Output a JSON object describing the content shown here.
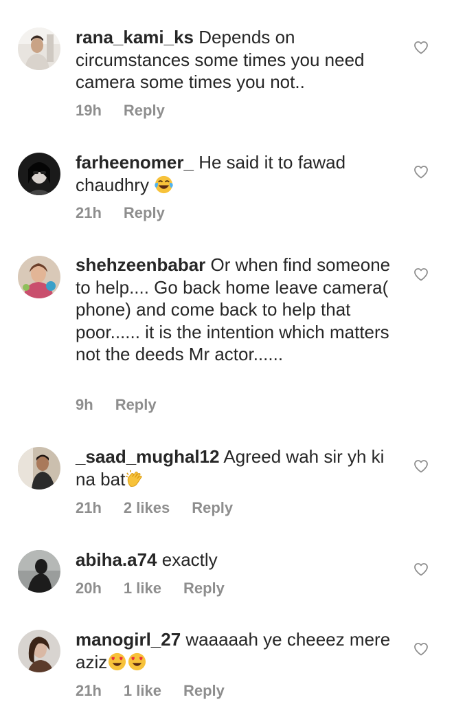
{
  "colors": {
    "text": "#262626",
    "meta": "#8e8e8e",
    "background": "#ffffff"
  },
  "comments": [
    {
      "username": "rana_kami_ks",
      "text": "Depends on circumstances some times you need camera some times you not..",
      "time": "19h",
      "likes": "",
      "reply": "Reply",
      "avatar_icon": "avatar-photo-man-icon"
    },
    {
      "username": "farheenomer_",
      "text": "He said it to fawad chaudhry",
      "emojis": [
        "face-with-tears-of-joy-icon"
      ],
      "time": "21h",
      "likes": "",
      "reply": "Reply",
      "avatar_icon": "avatar-photo-woman-icon"
    },
    {
      "username": "shehzeenbabar",
      "text": "Or when find someone to help.... Go back home leave camera( phone) and come back to help that poor...... it is the intention which matters not the deeds Mr actor......",
      "time": "9h",
      "likes": "",
      "reply": "Reply",
      "avatar_icon": "avatar-photo-woman-icon"
    },
    {
      "username": "_saad_mughal12",
      "text": "Agreed wah sir yh ki na bat",
      "emojis": [
        "clapping-hands-icon"
      ],
      "time": "21h",
      "likes": "2 likes",
      "reply": "Reply",
      "avatar_icon": "avatar-photo-man-icon"
    },
    {
      "username": "abiha.a74",
      "text": "exactly",
      "time": "20h",
      "likes": "1 like",
      "reply": "Reply",
      "avatar_icon": "avatar-silhouette-icon"
    },
    {
      "username": "manogirl_27",
      "text": "waaaaah ye cheeez mere aziz",
      "emojis": [
        "heart-eyes-icon",
        "heart-eyes-icon"
      ],
      "time": "21h",
      "likes": "1 like",
      "reply": "Reply",
      "avatar_icon": "avatar-photo-woman-icon"
    }
  ]
}
